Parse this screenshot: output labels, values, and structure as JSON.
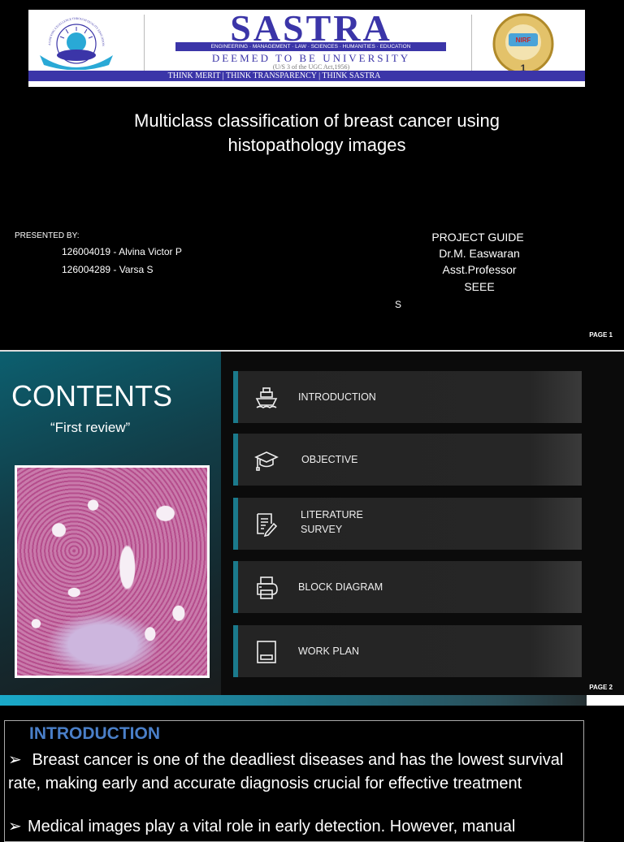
{
  "slide1": {
    "banner": {
      "left_logo_text": "ACHIEVING EXCELLENCE THROUGH QUALITY EDUCATION · SASTRA · THANJAVUR",
      "name": "SASTRA",
      "disciplines": "ENGINEERING · MANAGEMENT · LAW · SCIENCES · HUMANITIES · EDUCATION",
      "deemed": "DEEMED TO BE UNIVERSITY",
      "act": "(U/S 3 of the UGC Act,1956)",
      "motto": "THINK MERIT | THINK TRANSPARENCY | THINK SASTRA",
      "right_logo_text": "NIRF"
    },
    "title_line1": "Multiclass classification of breast cancer using",
    "title_line2": "histopathology images",
    "presented_by": "PRESENTED BY:",
    "students": [
      "126004019 - Alvina Victor P",
      "126004289 - Varsa S"
    ],
    "guide": [
      "PROJECT GUIDE",
      "Dr.M. Easwaran",
      "Asst.Professor",
      "SEEE"
    ],
    "stray_text": "S",
    "page": "PAGE 1"
  },
  "slide2": {
    "heading": "CONTENTS",
    "subheading": "“First review”",
    "items": [
      {
        "icon": "ship-icon",
        "label": "INTRODUCTION"
      },
      {
        "icon": "graduation-cap-icon",
        "label": "OBJECTIVE"
      },
      {
        "icon": "document-edit-icon",
        "label": "LITERATURE",
        "label2": "SURVEY"
      },
      {
        "icon": "printer-icon",
        "label": "BLOCK DIAGRAM"
      },
      {
        "icon": "tablet-icon",
        "label": "WORK PLAN"
      }
    ],
    "page": "PAGE 2",
    "accent": "#1b7a8c"
  },
  "slide3": {
    "heading": "INTRODUCTION",
    "heading_color": "#4a7fc8",
    "bullets": [
      " Breast cancer is one of the deadliest diseases and has the lowest survival rate, making early and accurate diagnosis crucial for effective treatment",
      "Medical images play a vital role in early detection. However, manual"
    ]
  }
}
